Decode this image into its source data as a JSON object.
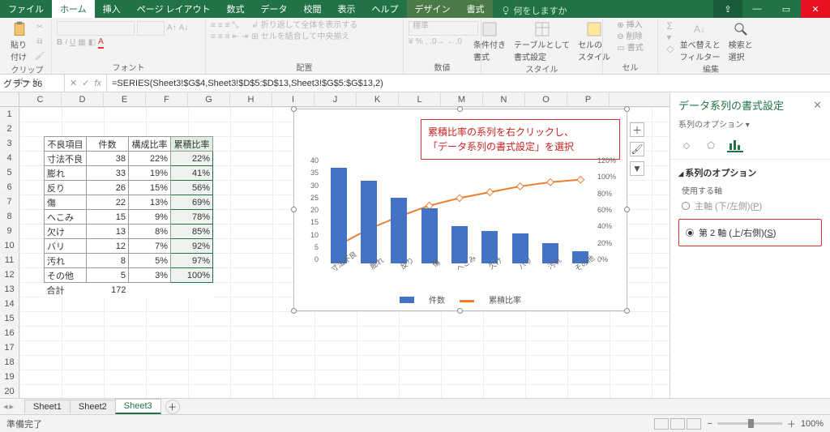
{
  "tabs": [
    "ファイル",
    "ホーム",
    "挿入",
    "ページ レイアウト",
    "数式",
    "データ",
    "校閲",
    "表示",
    "ヘルプ",
    "デザイン",
    "書式"
  ],
  "tellme": "何をしますか",
  "ribbon_groups": {
    "clipboard": {
      "paste": "貼り付け",
      "label": "クリップボード"
    },
    "font": {
      "label": "フォント",
      "sample": "A",
      "bold": "B",
      "italic": "I",
      "underline": "U"
    },
    "align": {
      "label": "配置",
      "wrap": "折り返して全体を表示する",
      "merge": "セルを結合して中央揃え"
    },
    "number": {
      "label": "数値",
      "std": "標準"
    },
    "styles": {
      "label": "スタイル",
      "cond": "条件付き\n書式",
      "table": "テーブルとして\n書式設定",
      "cell": "セルの\nスタイル"
    },
    "cells": {
      "label": "セル",
      "ins": "挿入",
      "del": "削除",
      "fmt": "書式"
    },
    "editing": {
      "label": "編集",
      "sort": "並べ替えと\nフィルター",
      "find": "検索と\n選択"
    }
  },
  "namebox": "グラフ 36",
  "formula": "=SERIES(Sheet3!$G$4,Sheet3!$D$5:$D$13,Sheet3!$G$5:$G$13,2)",
  "columns": [
    "C",
    "D",
    "E",
    "F",
    "G",
    "H",
    "I",
    "J",
    "K",
    "L",
    "M",
    "N",
    "O",
    "P"
  ],
  "rows": [
    "1",
    "2",
    "3",
    "4",
    "5",
    "6",
    "7",
    "8",
    "9",
    "10",
    "11",
    "12",
    "13",
    "14",
    "15",
    "16",
    "17",
    "18",
    "19",
    "20"
  ],
  "table": {
    "headers": [
      "不良項目",
      "件数",
      "構成比率",
      "累積比率"
    ],
    "rows": [
      [
        "寸法不良",
        "38",
        "22%",
        "22%"
      ],
      [
        "膨れ",
        "33",
        "19%",
        "41%"
      ],
      [
        "反り",
        "26",
        "15%",
        "56%"
      ],
      [
        "傷",
        "22",
        "13%",
        "69%"
      ],
      [
        "へこみ",
        "15",
        "9%",
        "78%"
      ],
      [
        "欠け",
        "13",
        "8%",
        "85%"
      ],
      [
        "バリ",
        "12",
        "7%",
        "92%"
      ],
      [
        "汚れ",
        "8",
        "5%",
        "97%"
      ],
      [
        "その他",
        "5",
        "3%",
        "100%"
      ]
    ],
    "total_label": "合計",
    "total": "172"
  },
  "chart_data": {
    "type": "pareto",
    "categories": [
      "寸法不良",
      "膨れ",
      "反り",
      "傷",
      "へこみ",
      "欠け",
      "バリ",
      "汚れ",
      "その他"
    ],
    "series": [
      {
        "name": "件数",
        "type": "bar",
        "values": [
          38,
          33,
          26,
          22,
          15,
          13,
          12,
          8,
          5
        ],
        "axis": "left",
        "color": "#4472c4"
      },
      {
        "name": "累積比率",
        "type": "line",
        "values": [
          22,
          41,
          56,
          69,
          78,
          85,
          92,
          97,
          100
        ],
        "axis": "right",
        "color": "#ed7d31"
      }
    ],
    "y_left": {
      "min": 0,
      "max": 40,
      "step": 5,
      "ticks": [
        "40",
        "35",
        "30",
        "25",
        "20",
        "15",
        "10",
        "5",
        "0"
      ]
    },
    "y_right": {
      "min": 0,
      "max": 120,
      "step": 20,
      "ticks": [
        "120%",
        "100%",
        "80%",
        "60%",
        "40%",
        "20%",
        "0%"
      ]
    },
    "legend": [
      "件数",
      "累積比率"
    ]
  },
  "annotation": {
    "line1": "累積比率の系列を右クリックし、",
    "line2": "「データ系列の書式設定」を選択"
  },
  "pane": {
    "title": "データ系列の書式設定",
    "subtitle": "系列のオプション",
    "section": "系列のオプション",
    "axis_label": "使用する軸",
    "primary": "主軸 (下/左側)(",
    "primary_key": "P",
    "primary_tail": ")",
    "secondary": "第 2 軸 (上/右側)(",
    "secondary_key": "S",
    "secondary_tail": ")"
  },
  "sheets": [
    "Sheet1",
    "Sheet2",
    "Sheet3"
  ],
  "status": {
    "ready": "準備完了",
    "zoom": "100%"
  }
}
